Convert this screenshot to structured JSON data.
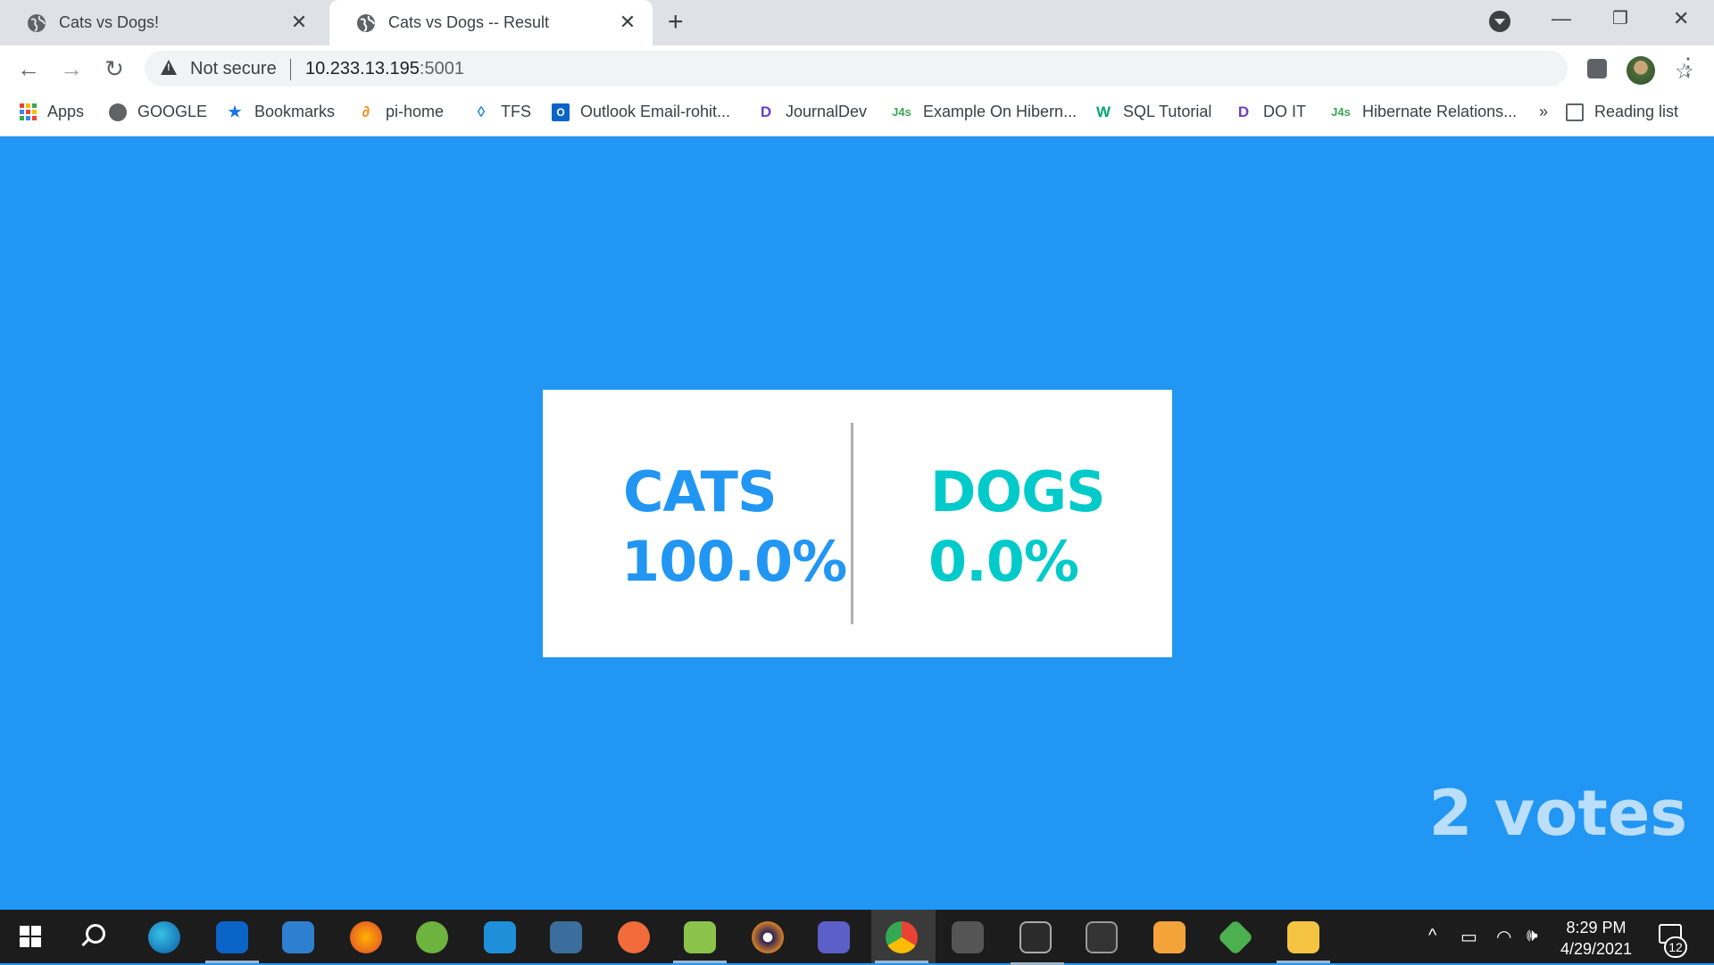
{
  "browser": {
    "tabs": [
      {
        "title": "Cats vs Dogs!",
        "active": false,
        "favicon": "globe-icon"
      },
      {
        "title": "Cats vs Dogs -- Result",
        "active": true,
        "favicon": "globe-icon"
      }
    ],
    "address": {
      "security_label": "Not secure",
      "host": "10.233.13.195",
      "port": ":5001"
    },
    "bookmarks": [
      {
        "label": "Apps",
        "icon": "apps-grid-icon"
      },
      {
        "label": "GOOGLE",
        "icon": "globe-icon"
      },
      {
        "label": "Bookmarks",
        "icon": "star-icon"
      },
      {
        "label": "pi-home",
        "icon": "pi-home-icon"
      },
      {
        "label": "TFS",
        "icon": "tfs-icon"
      },
      {
        "label": "Outlook Email-rohit...",
        "icon": "outlook-icon"
      },
      {
        "label": "JournalDev",
        "icon": "journaldev-icon"
      },
      {
        "label": "Example On Hibern...",
        "icon": "j4s-icon"
      },
      {
        "label": "SQL Tutorial",
        "icon": "w3schools-icon"
      },
      {
        "label": "DO IT",
        "icon": "journaldev-icon"
      },
      {
        "label": "Hibernate Relations...",
        "icon": "j4s-icon"
      }
    ],
    "overflow_label": "»",
    "reading_list": "Reading list"
  },
  "page": {
    "cats": {
      "label": "CATS",
      "percent": "100.0%"
    },
    "dogs": {
      "label": "DOGS",
      "percent": "0.0%"
    },
    "votes": "2 votes"
  },
  "colors": {
    "background": "#2196f3",
    "cats": "#2196f3",
    "dogs": "#00cbca",
    "votes": "#bbdefb"
  },
  "taskbar": {
    "time": "8:29 PM",
    "date": "4/29/2021",
    "notification_count": "12",
    "apps": [
      "edge-icon",
      "outlook-icon",
      "mail-icon",
      "firefox-icon",
      "spring-icon",
      "vscode-icon",
      "mysql-workbench-icon",
      "postman-icon",
      "notepad-icon",
      "eclipse-icon",
      "teams-icon",
      "chrome-icon",
      "vpn-icon",
      "snipping-icon",
      "terminal-icon",
      "file-transfer-icon",
      "git-icon",
      "file-explorer-icon"
    ]
  }
}
